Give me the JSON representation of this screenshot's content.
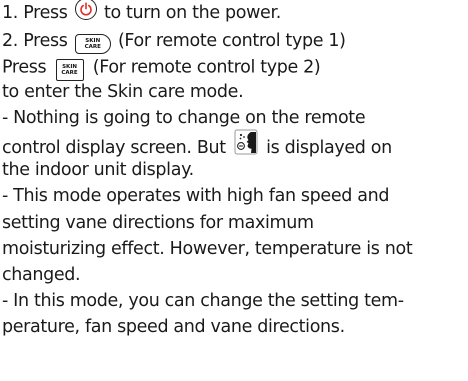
{
  "lines": {
    "l1_pre": "1. Press ",
    "l1_post": " to turn on the power.",
    "l2_pre": "2. Press ",
    "l2_post": " (For remote control type 1)",
    "l3_pre": "Press ",
    "l3_post": " (For remote control type 2)",
    "l4": "to enter the Skin care mode.",
    "l5": "- Nothing is going to change on the remote",
    "l6_pre": "control display screen. But ",
    "l6_post": " is displayed on",
    "l7": "the indoor unit display.",
    "l8": "- This mode operates with high fan speed and",
    "l9": "setting vane directions for maximum",
    "l10": "moisturizing effect. However, temperature is not",
    "l11": "changed.",
    "l12": "- In this mode, you can change the setting tem-",
    "l13": "perature, fan speed and vane directions."
  },
  "keys": {
    "skin_line1": "SKIN",
    "skin_line2": "CARE"
  },
  "icons": {
    "power": "power-button-icon",
    "skin_care_type1": "skin-care-key-rounded",
    "skin_care_type2": "skin-care-key-square",
    "indoor_display": "skin-care-display-symbol"
  }
}
